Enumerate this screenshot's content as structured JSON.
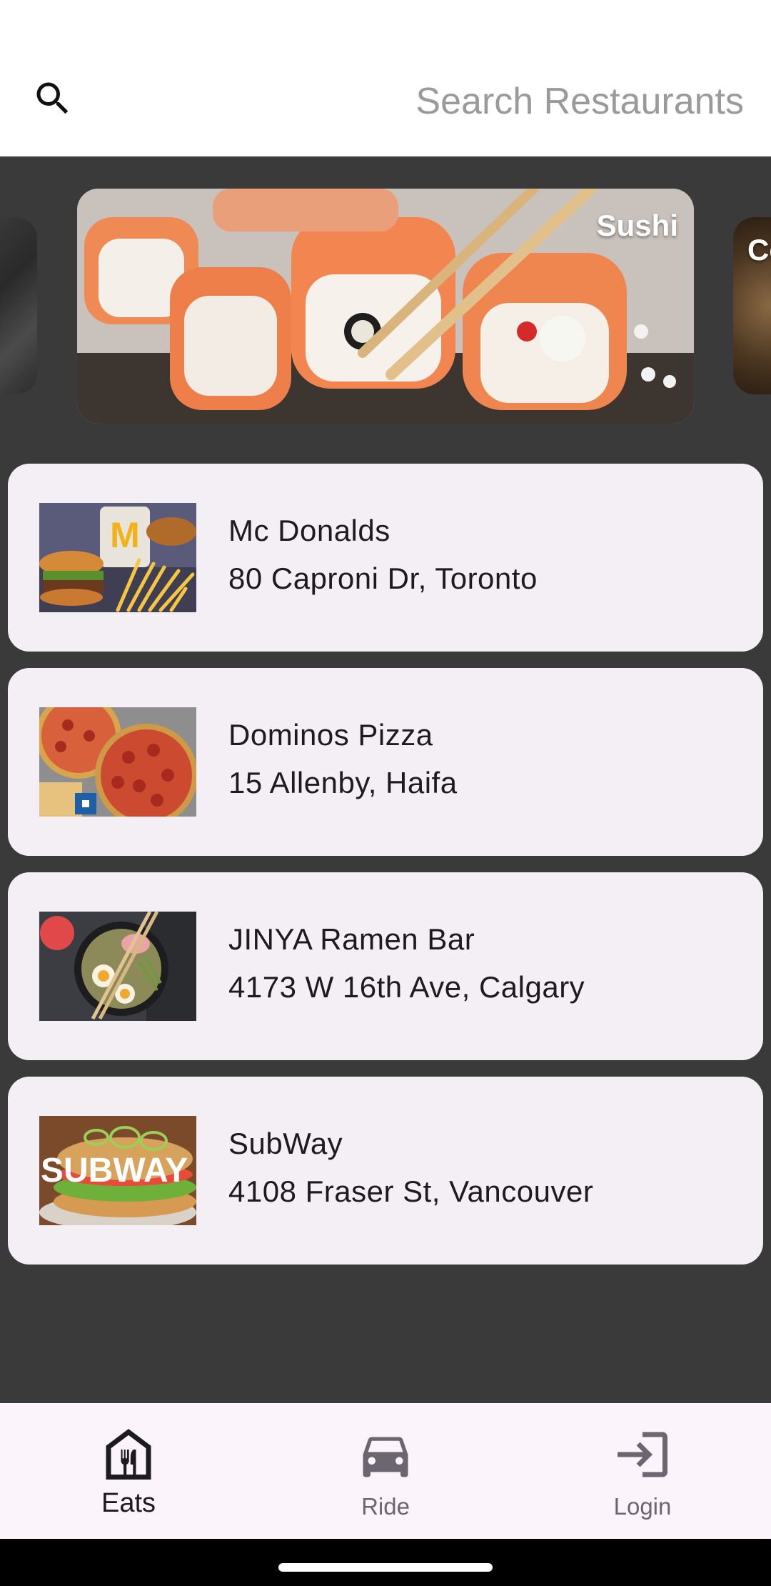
{
  "search": {
    "placeholder": "Search Restaurants"
  },
  "categories": [
    {
      "label": ""
    },
    {
      "label": "Sushi"
    },
    {
      "label": "Co"
    }
  ],
  "restaurants": [
    {
      "name": "Mc Donalds",
      "address": "80 Caproni Dr, Toronto"
    },
    {
      "name": "Dominos Pizza",
      "address": "15 Allenby, Haifa"
    },
    {
      "name": "JINYA Ramen Bar",
      "address": "4173 W 16th Ave, Calgary"
    },
    {
      "name": "SubWay",
      "address": "4108 Fraser St, Vancouver"
    }
  ],
  "thumb_text": {
    "subway": "SUBWAY"
  },
  "nav": [
    {
      "label": "Eats",
      "icon": "storefront-icon",
      "active": true
    },
    {
      "label": "Ride",
      "icon": "car-icon",
      "active": false
    },
    {
      "label": "Login",
      "icon": "login-icon",
      "active": false
    }
  ],
  "colors": {
    "background": "#3a3a3a",
    "card": "#f4eff5",
    "nav_background": "#fbf4fb",
    "text": "#1d1b20",
    "muted": "#6b6670",
    "placeholder": "#9a9a9a"
  }
}
